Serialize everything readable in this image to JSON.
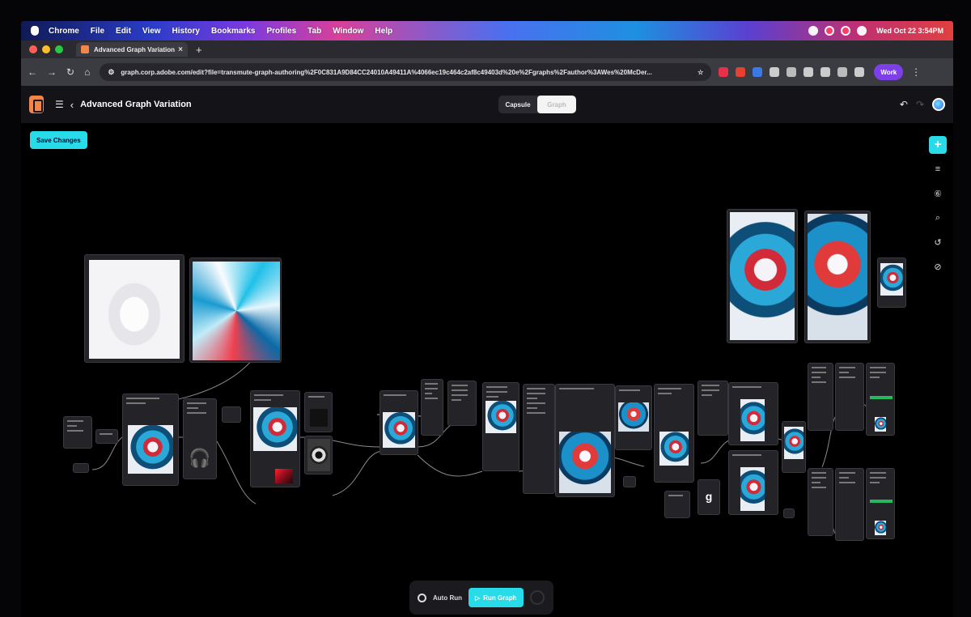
{
  "menubar": {
    "items": [
      "Chrome",
      "File",
      "Edit",
      "View",
      "History",
      "Bookmarks",
      "Profiles",
      "Tab",
      "Window",
      "Help"
    ],
    "clock": "Wed Oct 22  3:54PM"
  },
  "browser": {
    "tab_title": "Advanced Graph Variation",
    "tab_close": "×",
    "new_tab": "+",
    "url": "graph.corp.adobe.com/edit?file=transmute-graph-authoring%2F0C831A9D84CC24010A49411A%4066ec19c464c2af8c49403d%20e%2Fgraphs%2Fauthor%3AWes%20McDer...",
    "profile_label": "Work"
  },
  "app": {
    "graph_title": "Advanced Graph Variation",
    "mode_tabs": [
      "Capsule",
      "Graph"
    ],
    "active_mode": "Graph",
    "save_label": "Save Changes"
  },
  "toolbar": {
    "auto_run_label": "Auto Run",
    "run_label": "Run Graph"
  },
  "colors": {
    "accent": "#27dbe8",
    "app_logo": "#f2854a",
    "profile": "#7d40e8"
  },
  "icons": {
    "right_tools": [
      "plus-icon",
      "sliders-icon",
      "history-badge-icon",
      "search-icon",
      "restore-icon",
      "link-icon"
    ]
  }
}
